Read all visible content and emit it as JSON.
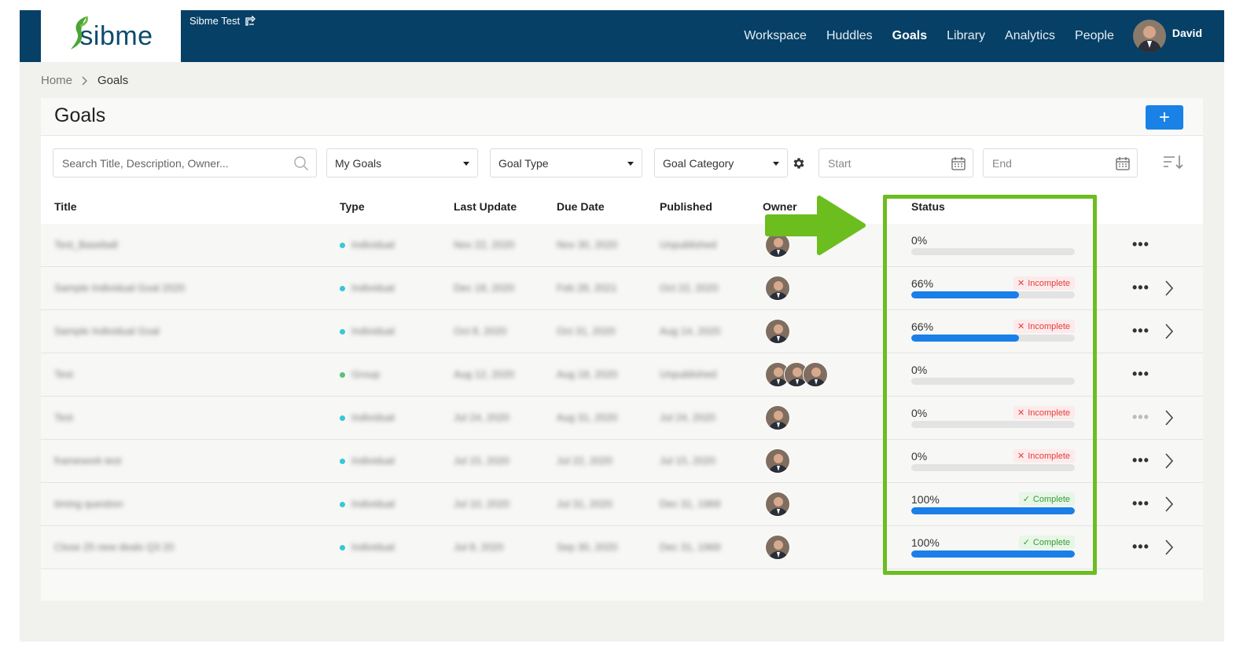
{
  "app": {
    "logo_text": "sibme",
    "account_name": "Sibme Test",
    "user_name": "David"
  },
  "nav": {
    "items": [
      "Workspace",
      "Huddles",
      "Goals",
      "Library",
      "Analytics",
      "People"
    ],
    "active": "Goals"
  },
  "breadcrumb": [
    "Home",
    "Goals"
  ],
  "page": {
    "title": "Goals",
    "add_label": "+"
  },
  "filters": {
    "search_placeholder": "Search Title, Description, Owner...",
    "owner_filter": "My Goals",
    "goal_type": "Goal Type",
    "goal_category": "Goal Category",
    "start_placeholder": "Start",
    "end_placeholder": "End"
  },
  "columns": [
    "Title",
    "Type",
    "Last Update",
    "Due Date",
    "Published",
    "Owner",
    "Status"
  ],
  "rows": [
    {
      "title": "Test_Baseball",
      "type": "Individual",
      "last_update": "Nov 22, 2020",
      "due_date": "Nov 30, 2020",
      "published": "Unpublished",
      "owners": 1,
      "progress": "0%",
      "status": "",
      "chevron": false
    },
    {
      "title": "Sample Individual Goal 2020",
      "type": "Individual",
      "last_update": "Dec 18, 2020",
      "due_date": "Feb 28, 2021",
      "published": "Oct 22, 2020",
      "owners": 1,
      "progress": "66%",
      "status": "Incomplete",
      "chevron": true
    },
    {
      "title": "Sample Individual Goal",
      "type": "Individual",
      "last_update": "Oct 8, 2020",
      "due_date": "Oct 31, 2020",
      "published": "Aug 14, 2020",
      "owners": 1,
      "progress": "66%",
      "status": "Incomplete",
      "chevron": true
    },
    {
      "title": "Test",
      "type": "Group",
      "last_update": "Aug 12, 2020",
      "due_date": "Aug 18, 2020",
      "published": "Unpublished",
      "owners": 3,
      "progress": "0%",
      "status": "",
      "chevron": false
    },
    {
      "title": "Test",
      "type": "Individual",
      "last_update": "Jul 24, 2020",
      "due_date": "Aug 31, 2020",
      "published": "Jul 24, 2020",
      "owners": 1,
      "progress": "0%",
      "status": "Incomplete",
      "chevron": true
    },
    {
      "title": "framework test",
      "type": "Individual",
      "last_update": "Jul 15, 2020",
      "due_date": "Jul 22, 2020",
      "published": "Jul 15, 2020",
      "owners": 1,
      "progress": "0%",
      "status": "Incomplete",
      "chevron": true
    },
    {
      "title": "timing question",
      "type": "Individual",
      "last_update": "Jul 10, 2020",
      "due_date": "Jul 31, 2020",
      "published": "Dec 31, 1969",
      "owners": 1,
      "progress": "100%",
      "status": "Complete",
      "chevron": true
    },
    {
      "title": "Close 25 new deals Q3 20",
      "type": "Individual",
      "last_update": "Jul 8, 2020",
      "due_date": "Sep 30, 2020",
      "published": "Dec 31, 1969",
      "owners": 1,
      "progress": "100%",
      "status": "Complete",
      "chevron": true
    }
  ],
  "colors": {
    "header_bg": "#064066",
    "accent_blue": "#1a82e6",
    "highlight_green": "#6cbd1e",
    "incomplete_red": "#e23e3e",
    "complete_green": "#3a9b3a"
  }
}
